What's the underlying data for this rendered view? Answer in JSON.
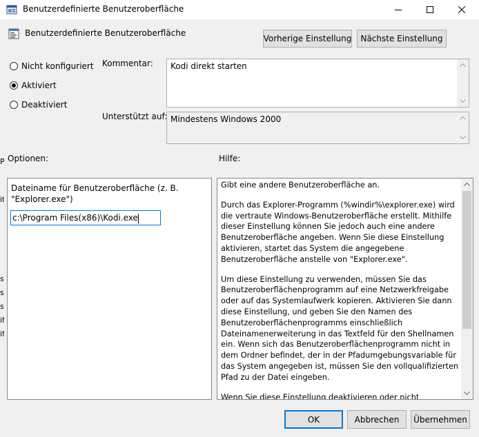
{
  "window": {
    "title": "Benutzerdefinierte Benutzeroberfläche",
    "icon": "policy-window-icon"
  },
  "header": {
    "title": "Benutzerdefinierte Benutzeroberfläche",
    "prev_button": "Vorherige Einstellung",
    "next_button": "Nächste Einstellung"
  },
  "state": {
    "options": [
      {
        "label": "Nicht konfiguriert",
        "checked": false
      },
      {
        "label": "Aktiviert",
        "checked": true
      },
      {
        "label": "Deaktiviert",
        "checked": false
      }
    ]
  },
  "comment": {
    "label": "Kommentar:",
    "value": "Kodi direkt starten"
  },
  "supported": {
    "label": "Unterstützt auf:",
    "value": "Mindestens Windows 2000"
  },
  "options_section": {
    "label": "Optionen:",
    "field_label": "Dateiname für Benutzeroberfläche (z. B. \"Explorer.exe\")",
    "field_value": "c:\\Program Files(x86)\\Kodi.exe"
  },
  "help_section": {
    "label": "Hilfe:",
    "paragraphs": [
      "Gibt eine andere Benutzeroberfläche an.",
      "Durch das Explorer-Programm (%windir%\\explorer.exe) wird die vertraute Windows-Benutzeroberfläche erstellt. Mithilfe dieser Einstellung können Sie jedoch auch eine andere Benutzeroberfläche angeben. Wenn Sie diese Einstellung aktivieren, startet das System die angegebene Benutzeroberfläche anstelle von \"Explorer.exe\".",
      "Um diese Einstellung zu verwenden, müssen Sie das Benutzeroberflächenprogramm auf eine Netzwerkfreigabe oder auf das Systemlaufwerk kopieren. Aktivieren Sie dann diese Einstellung, und geben Sie den Namen des Benutzeroberflächenprogramms einschließlich Dateinamenerweiterung in das Textfeld für den Shellnamen ein. Wenn sich das Benutzeroberflächenprogramm nicht in dem Ordner befindet, der in der Pfadumgebungsvariable für das System angegeben ist, müssen Sie den vollqualifizierten Pfad zu der Datei eingeben.",
      "Wenn Sie diese Einstellung deaktivieren oder nicht konfigurieren,"
    ]
  },
  "footer": {
    "ok": "OK",
    "cancel": "Abbrechen",
    "apply": "Übernehmen"
  },
  "background_fragments": [
    "P",
    "it",
    "s",
    "s",
    "s",
    "if",
    "if"
  ]
}
